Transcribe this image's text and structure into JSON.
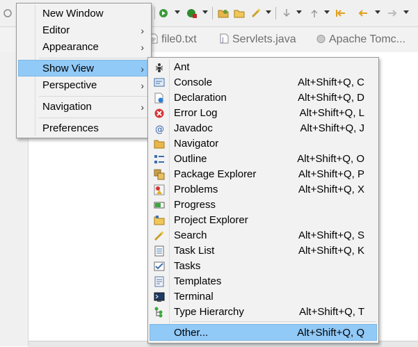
{
  "tabs": [
    {
      "name": "file0.txt",
      "icon": "text-file-icon"
    },
    {
      "name": "Servlets.java",
      "icon": "java-file-icon"
    },
    {
      "name": "Apache Tomc...",
      "icon": "browser-globe-icon"
    }
  ],
  "window_menu": {
    "items": [
      {
        "label": "New Window",
        "submenu": false
      },
      {
        "label": "Editor",
        "submenu": true
      },
      {
        "label": "Appearance",
        "submenu": true
      },
      {
        "label": "Show View",
        "submenu": true,
        "highlighted": true
      },
      {
        "label": "Perspective",
        "submenu": true
      },
      {
        "label": "Navigation",
        "submenu": true
      },
      {
        "label": "Preferences",
        "submenu": false
      }
    ],
    "submenu_arrow": "›"
  },
  "show_view_menu": {
    "items": [
      {
        "label": "Ant",
        "shortcut": "",
        "icon": "ant-icon"
      },
      {
        "label": "Console",
        "shortcut": "Alt+Shift+Q, C",
        "icon": "console-icon"
      },
      {
        "label": "Declaration",
        "shortcut": "Alt+Shift+Q, D",
        "icon": "declaration-icon"
      },
      {
        "label": "Error Log",
        "shortcut": "Alt+Shift+Q, L",
        "icon": "error-log-icon"
      },
      {
        "label": "Javadoc",
        "shortcut": "Alt+Shift+Q, J",
        "icon": "javadoc-icon"
      },
      {
        "label": "Navigator",
        "shortcut": "",
        "icon": "navigator-icon"
      },
      {
        "label": "Outline",
        "shortcut": "Alt+Shift+Q, O",
        "icon": "outline-icon"
      },
      {
        "label": "Package Explorer",
        "shortcut": "Alt+Shift+Q, P",
        "icon": "package-explorer-icon"
      },
      {
        "label": "Problems",
        "shortcut": "Alt+Shift+Q, X",
        "icon": "problems-icon"
      },
      {
        "label": "Progress",
        "shortcut": "",
        "icon": "progress-icon"
      },
      {
        "label": "Project Explorer",
        "shortcut": "",
        "icon": "project-explorer-icon"
      },
      {
        "label": "Search",
        "shortcut": "Alt+Shift+Q, S",
        "icon": "search-icon"
      },
      {
        "label": "Task List",
        "shortcut": "Alt+Shift+Q, K",
        "icon": "task-list-icon"
      },
      {
        "label": "Tasks",
        "shortcut": "",
        "icon": "tasks-icon"
      },
      {
        "label": "Templates",
        "shortcut": "",
        "icon": "templates-icon"
      },
      {
        "label": "Terminal",
        "shortcut": "",
        "icon": "terminal-icon"
      },
      {
        "label": "Type Hierarchy",
        "shortcut": "Alt+Shift+Q, T",
        "icon": "type-hierarchy-icon"
      },
      {
        "label": "Other...",
        "shortcut": "Alt+Shift+Q, Q",
        "icon": "",
        "highlighted": true
      }
    ]
  },
  "colors": {
    "menu_bg": "#f2f2f2",
    "highlight": "#91c9f7",
    "toolbar_bg": "#f0f0f0"
  }
}
